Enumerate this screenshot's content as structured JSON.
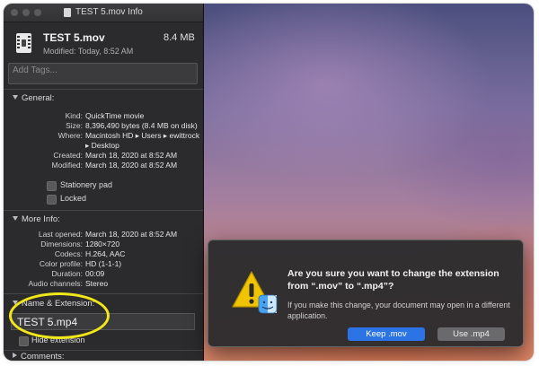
{
  "info_window": {
    "title": "TEST 5.mov Info",
    "file_name": "TEST 5.mov",
    "file_size": "8.4 MB",
    "modified_summary": "Modified: Today, 8:52 AM",
    "tags_placeholder": "Add Tags...",
    "general": {
      "header": "General:",
      "kind_label": "Kind:",
      "kind_value": "QuickTime movie",
      "size_label": "Size:",
      "size_value": "8,396,490 bytes (8.4 MB on disk)",
      "where_label": "Where:",
      "where_value_1": "Macintosh HD ▸ Users ▸ ewittrock",
      "where_value_2": "▸ Desktop",
      "created_label": "Created:",
      "created_value": "March 18, 2020 at 8:52 AM",
      "modified_label": "Modified:",
      "modified_value": "March 18, 2020 at 8:52 AM",
      "stationery_label": "Stationery pad",
      "locked_label": "Locked"
    },
    "more_info": {
      "header": "More Info:",
      "last_opened_label": "Last opened:",
      "last_opened_value": "March 18, 2020 at 8:52 AM",
      "dimensions_label": "Dimensions:",
      "dimensions_value": "1280×720",
      "codecs_label": "Codecs:",
      "codecs_value": "H.264, AAC",
      "color_profile_label": "Color profile:",
      "color_profile_value": "HD (1-1-1)",
      "duration_label": "Duration:",
      "duration_value": "00:09",
      "audio_label": "Audio channels:",
      "audio_value": "Stereo"
    },
    "name_extension": {
      "header": "Name & Extension:",
      "value": "TEST 5.mp4",
      "hide_extension_label": "Hide extension"
    },
    "comments_header": "Comments:"
  },
  "alert": {
    "title": "Are you sure you want to change the extension from “.mov” to “.mp4”?",
    "body": "If you make this change, your document may open in a different application.",
    "primary_button": "Keep .mov",
    "secondary_button": "Use .mp4"
  },
  "colors": {
    "highlight_ellipse": "#f1e61a",
    "primary_button": "#2c74e5",
    "warning_icon": "#f0c400"
  },
  "icons": [
    "movie-file-icon",
    "warning-icon",
    "finder-icon",
    "disclosure-triangle-icon"
  ]
}
